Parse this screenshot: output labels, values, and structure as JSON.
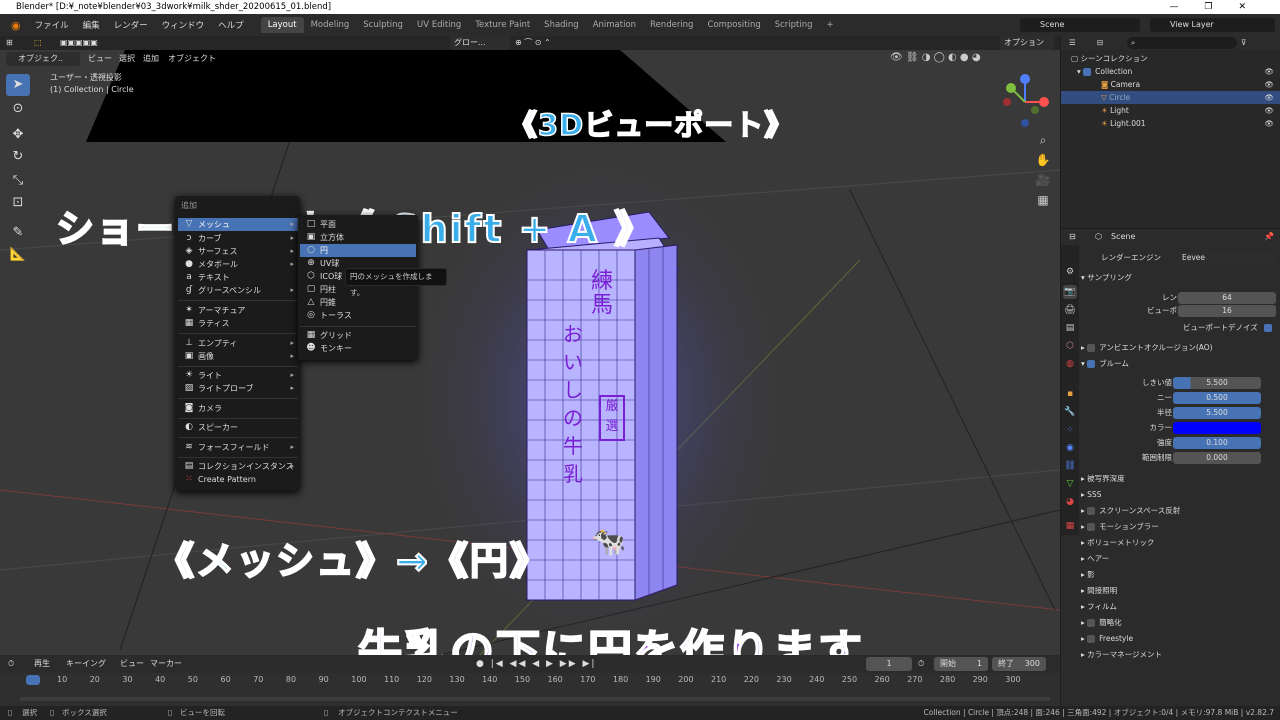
{
  "window": {
    "title": "Blender* [D:¥_note¥blender¥03_3dwork¥milk_shder_20200615_01.blend]",
    "controls": [
      "—",
      "❐",
      "✕"
    ]
  },
  "menubar": {
    "menus": [
      "ファイル",
      "編集",
      "レンダー",
      "ウィンドウ",
      "ヘルプ"
    ],
    "workspaces": [
      "Layout",
      "Modeling",
      "Sculpting",
      "UV Editing",
      "Texture Paint",
      "Shading",
      "Animation",
      "Rendering",
      "Compositing",
      "Scripting"
    ],
    "active_workspace": "Layout",
    "add_tab": "+",
    "scene": "Scene",
    "view_layer": "View Layer"
  },
  "viewport_header": {
    "mode": "オブジェク..",
    "menus": [
      "ビュー",
      "選択",
      "追加",
      "オブジェクト"
    ],
    "transform": "グロー...",
    "options": "オプション"
  },
  "viewport_info": {
    "line1": "ユーザー・透視投影",
    "line2": "(1) Collection | Circle"
  },
  "overlays": {
    "title": "《3Dビューポート》",
    "shortcut": "ショートカット《 Shift + A 》",
    "path": "《メッシュ》→《円》",
    "note": "牛乳の下に円を作ります"
  },
  "add_menu": {
    "title": "追加",
    "items": [
      {
        "label": "メッシュ",
        "icon": "▽",
        "arrow": "▸",
        "highlighted": true
      },
      {
        "label": "カーブ",
        "icon": "ↄ",
        "arrow": "▸"
      },
      {
        "label": "サーフェス",
        "icon": "◈",
        "arrow": "▸"
      },
      {
        "label": "メタボール",
        "icon": "●",
        "arrow": "▸"
      },
      {
        "label": "テキスト",
        "icon": "a",
        "arrow": ""
      },
      {
        "label": "グリースペンシル",
        "icon": "ɠ",
        "arrow": "▸"
      },
      {
        "label": "アーマチュア",
        "icon": "✶",
        "arrow": ""
      },
      {
        "label": "ラティス",
        "icon": "▦",
        "arrow": ""
      },
      {
        "label": "エンプティ",
        "icon": "⊥",
        "arrow": "▸"
      },
      {
        "label": "画像",
        "icon": "▣",
        "arrow": "▸"
      },
      {
        "label": "ライト",
        "icon": "☀",
        "arrow": "▸"
      },
      {
        "label": "ライトプローブ",
        "icon": "▨",
        "arrow": "▸"
      },
      {
        "label": "カメラ",
        "icon": "◙",
        "arrow": ""
      },
      {
        "label": "スピーカー",
        "icon": "◐",
        "arrow": ""
      },
      {
        "label": "フォースフィールド",
        "icon": "≋",
        "arrow": "▸"
      },
      {
        "label": "コレクションインスタンス",
        "icon": "▤",
        "arrow": "▸"
      },
      {
        "label": "Create Pattern",
        "icon": "⁙",
        "arrow": ""
      }
    ]
  },
  "mesh_submenu": {
    "items": [
      {
        "label": "平面",
        "icon": "□"
      },
      {
        "label": "立方体",
        "icon": "▣"
      },
      {
        "label": "円",
        "icon": "○",
        "highlighted": true
      },
      {
        "label": "UV球",
        "icon": "⊕"
      },
      {
        "label": "ICO球",
        "icon": "⬡"
      },
      {
        "label": "円柱",
        "icon": "▢"
      },
      {
        "label": "円錐",
        "icon": "△"
      },
      {
        "label": "トーラス",
        "icon": "◎"
      },
      {
        "label": "グリッド",
        "icon": "▦"
      },
      {
        "label": "モンキー",
        "icon": "☻"
      }
    ],
    "tooltip": "円のメッシュを作成します。"
  },
  "carton_text": {
    "name_top": "練馬",
    "name_main": "おいしの牛乳",
    "stamp": "厳選"
  },
  "timeline": {
    "menus": [
      "再生",
      "キーイング",
      "ビュー",
      "マーカー"
    ],
    "current_frame": "1",
    "start_label": "開始",
    "start": "1",
    "end_label": "終了",
    "end": "300",
    "ticks": [
      "1",
      "10",
      "20",
      "30",
      "40",
      "50",
      "60",
      "70",
      "80",
      "90",
      "100",
      "110",
      "120",
      "130",
      "140",
      "150",
      "160",
      "170",
      "180",
      "190",
      "200",
      "210",
      "220",
      "230",
      "240",
      "250",
      "260",
      "270",
      "280",
      "290",
      "300"
    ]
  },
  "statusbar": {
    "select": "選択",
    "box_select": "ボックス選択",
    "rotate_view": "ビューを回転",
    "context_menu": "オブジェクトコンテクストメニュー",
    "stats": "Collection | Circle | 頂点:248 | 面:246 | 三角面:492 | オブジェクト:0/4 | メモリ:97.8 MiB | v2.82.7"
  },
  "outliner": {
    "scene_collection": "シーンコレクション",
    "items": [
      {
        "label": "Collection",
        "indent": 1
      },
      {
        "label": "Camera",
        "indent": 2
      },
      {
        "label": "Circle",
        "indent": 2,
        "selected": true
      },
      {
        "label": "Light",
        "indent": 2
      },
      {
        "label": "Light.001",
        "indent": 2
      }
    ]
  },
  "properties": {
    "scene": "Scene",
    "render_engine_label": "レンダーエンジン",
    "render_engine": "Eevee",
    "sampling": {
      "title": "サンプリング",
      "render_label": "レンダー",
      "render": "64",
      "viewport_label": "ビューポート",
      "viewport": "16",
      "denoise": "ビューポートデノイズ"
    },
    "ao": "アンビエントオクルージョン(AO)",
    "bloom": {
      "title": "ブルーム",
      "threshold_label": "しきい値",
      "threshold": "5.500",
      "knee_label": "ニー",
      "knee": "0.500",
      "radius_label": "半径",
      "radius": "5.500",
      "color_label": "カラー",
      "color": "#0000ff",
      "intensity_label": "強度",
      "intensity": "0.100",
      "clamp_label": "範囲制限",
      "clamp": "0.000"
    },
    "panels": [
      "被写界深度",
      "SSS",
      "スクリーンスペース反射",
      "モーションブラー",
      "ボリューメトリック",
      "ヘアー",
      "影",
      "間接照明",
      "フィルム",
      "簡略化",
      "Freestyle",
      "カラーマネージメント"
    ]
  }
}
